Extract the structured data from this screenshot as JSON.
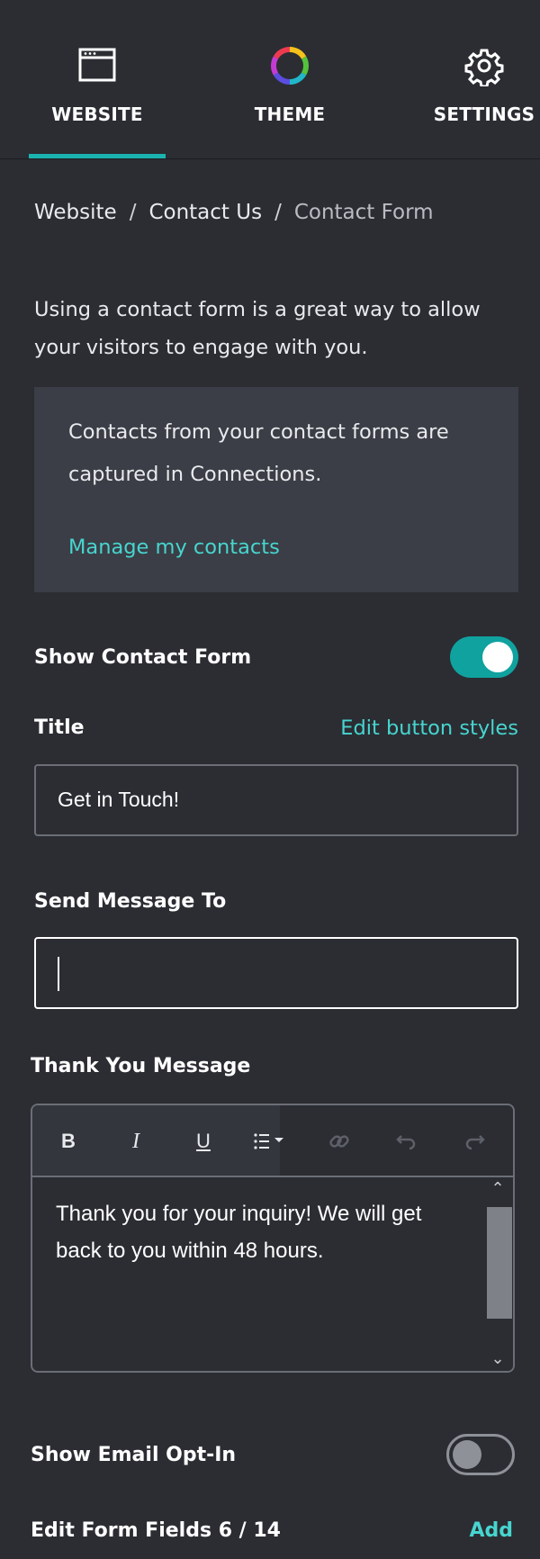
{
  "tabs": {
    "website": {
      "label": "WEBSITE",
      "icon": "browser-window-icon",
      "active": true
    },
    "theme": {
      "label": "THEME",
      "icon": "color-wheel-icon"
    },
    "settings": {
      "label": "SETTINGS",
      "icon": "gear-icon"
    }
  },
  "breadcrumb": {
    "items": [
      "Website",
      "Contact Us",
      "Contact Form"
    ],
    "separator": "/"
  },
  "intro": "Using a contact form is a great way to allow your visitors to engage with you.",
  "info_box": {
    "text": "Contacts from your contact forms are captured in Connections.",
    "link": "Manage my contacts"
  },
  "show_contact_form": {
    "label": "Show Contact Form",
    "enabled": true
  },
  "title_field": {
    "label": "Title",
    "edit_link": "Edit button styles",
    "value": "Get in Touch!"
  },
  "send_to": {
    "label": "Send Message To",
    "value": ""
  },
  "thank_you": {
    "label": "Thank You Message",
    "toolbar": {
      "bold": "B",
      "italic": "I",
      "underline": "U",
      "list": "list-icon",
      "link": "link-icon",
      "undo": "undo-icon",
      "redo": "redo-icon"
    },
    "body": "Thank you for your inquiry! We will get back to you within 48 hours."
  },
  "email_opt_in": {
    "label": "Show Email Opt-In",
    "enabled": false
  },
  "form_fields": {
    "label": "Edit Form Fields 6 / 14",
    "add": "Add"
  },
  "colors": {
    "background": "#2b2d33",
    "accent": "#1bb3b0",
    "link": "#47d5cf",
    "info_box": "#3b3e46"
  }
}
